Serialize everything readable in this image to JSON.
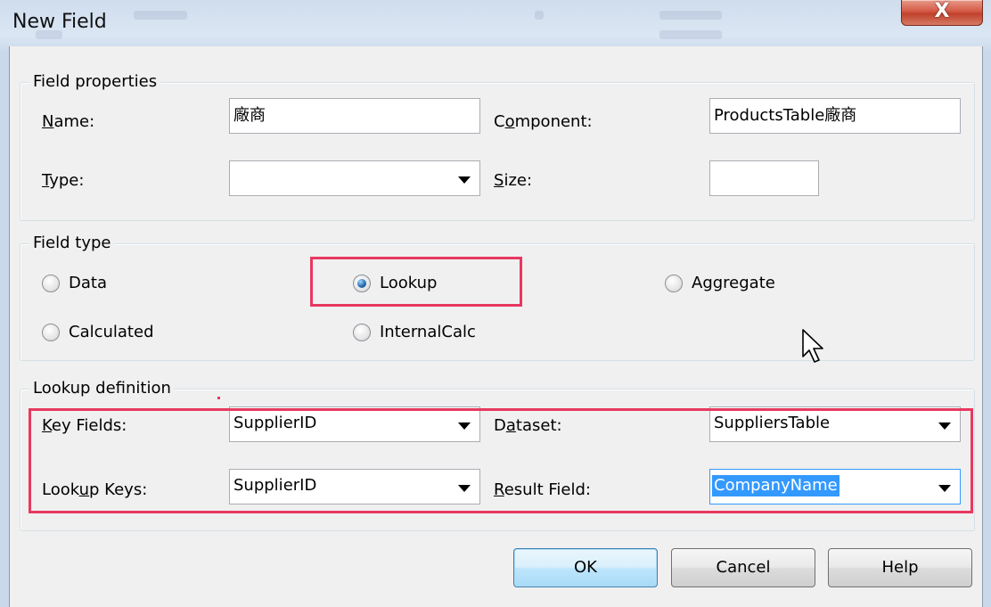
{
  "window": {
    "title": "New Field",
    "close_glyph": "X"
  },
  "field_properties": {
    "legend": "Field properties",
    "name_label_u": "N",
    "name_label_rest": "ame:",
    "name_value": "廠商",
    "component_label_pre": "C",
    "component_label_u": "o",
    "component_label_rest": "mponent:",
    "component_value": "ProductsTable廠商",
    "type_label_u": "T",
    "type_label_rest": "ype:",
    "type_value": "",
    "size_label_u": "S",
    "size_label_rest": "ize:",
    "size_value": ""
  },
  "field_type": {
    "legend": "Field type",
    "options": {
      "data": "Data",
      "lookup": "Lookup",
      "aggregate": "Aggregate",
      "calculated": "Calculated",
      "internalcalc": "InternalCalc"
    },
    "selected": "lookup"
  },
  "lookup_definition": {
    "legend": "Lookup definition",
    "key_fields_label_u": "K",
    "key_fields_label_rest": "ey Fields:",
    "key_fields_value": "SupplierID",
    "dataset_label_pre": "D",
    "dataset_label_u": "a",
    "dataset_label_rest": "taset:",
    "dataset_value": "SuppliersTable",
    "lookup_keys_label_pre": "Look",
    "lookup_keys_label_u": "u",
    "lookup_keys_label_rest": "p Keys:",
    "lookup_keys_value": "SupplierID",
    "result_field_label_u": "R",
    "result_field_label_rest": "esult Field:",
    "result_field_value": "CompanyName"
  },
  "buttons": {
    "ok": "OK",
    "cancel": "Cancel",
    "help": "Help"
  },
  "colors": {
    "highlight": "#e83860",
    "selection": "#3399ff"
  }
}
